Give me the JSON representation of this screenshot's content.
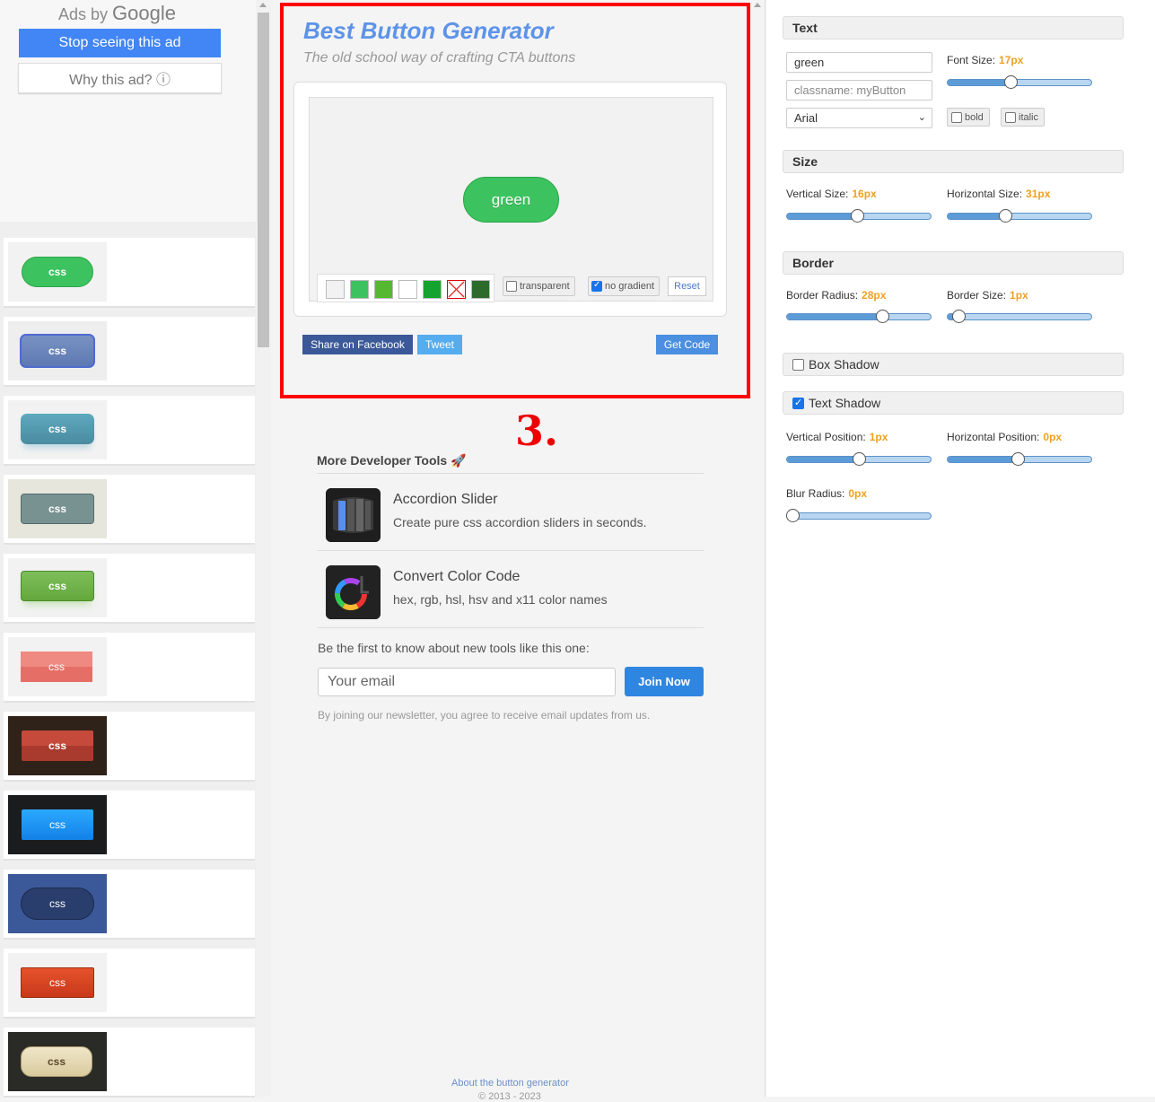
{
  "ad": {
    "ads_by": "Ads by",
    "google": "Google",
    "stop_label": "Stop seeing this ad",
    "why_label": "Why this ad? ⓘ"
  },
  "presets": [
    {
      "label": "css"
    },
    {
      "label": "css"
    },
    {
      "label": "css"
    },
    {
      "label": "css"
    },
    {
      "label": "css"
    },
    {
      "label": "css"
    },
    {
      "label": "css"
    },
    {
      "label": "css"
    },
    {
      "label": "css"
    },
    {
      "label": "css"
    },
    {
      "label": "css"
    }
  ],
  "generator": {
    "title": "Best Button Generator",
    "subtitle": "The old school way of crafting CTA buttons",
    "preview_label": "green",
    "transparent_label": "transparent",
    "no_gradient_label": "no gradient",
    "reset_label": "Reset",
    "share_facebook": "Share on Facebook",
    "tweet": "Tweet",
    "get_code": "Get Code",
    "swatch_colors": [
      "#f2f2f2",
      "#3cc35f",
      "#55b830",
      "#ffffff",
      "#14a32e",
      "none",
      "#2c6b2c"
    ]
  },
  "annotation": "3.",
  "tools": {
    "heading": "More Developer Tools 🚀",
    "items": [
      {
        "title": "Accordion Slider",
        "desc": "Create pure css accordion sliders in seconds."
      },
      {
        "title": "Convert Color Code",
        "desc": "hex, rgb, hsl, hsv and x11 color names"
      }
    ]
  },
  "newsletter": {
    "prompt": "Be the first to know about new tools like this one:",
    "placeholder": "Your email",
    "join_label": "Join Now",
    "legal": "By joining our newsletter, you agree to receive email updates from us."
  },
  "footer": {
    "about": "About the button generator",
    "copyright": "© 2013 - 2023"
  },
  "panel": {
    "text": {
      "title": "Text",
      "text_value": "green",
      "class_placeholder": "classname: myButton",
      "font": "Arial",
      "font_size_label": "Font Size:",
      "font_size_value": "17px",
      "bold_label": "bold",
      "italic_label": "italic"
    },
    "size": {
      "title": "Size",
      "vertical_label": "Vertical Size:",
      "vertical_value": "16px",
      "horizontal_label": "Horizontal Size:",
      "horizontal_value": "31px"
    },
    "border": {
      "title": "Border",
      "radius_label": "Border Radius:",
      "radius_value": "28px",
      "size_label": "Border Size:",
      "size_value": "1px"
    },
    "box_shadow": {
      "title": "Box Shadow",
      "checked": false
    },
    "text_shadow": {
      "title": "Text Shadow",
      "checked": true,
      "vertical_label": "Vertical Position:",
      "vertical_value": "1px",
      "horizontal_label": "Horizontal Position:",
      "horizontal_value": "0px",
      "blur_label": "Blur Radius:",
      "blur_value": "0px"
    },
    "slider_levels": {
      "font_size": 0.44,
      "vertical_size": 0.49,
      "horizontal_size": 0.4,
      "border_radius": 0.66,
      "border_size": 0.08,
      "ts_vertical": 0.5,
      "ts_horizontal": 0.49,
      "ts_blur": 0.0
    },
    "accent_color": "#f0a020"
  }
}
